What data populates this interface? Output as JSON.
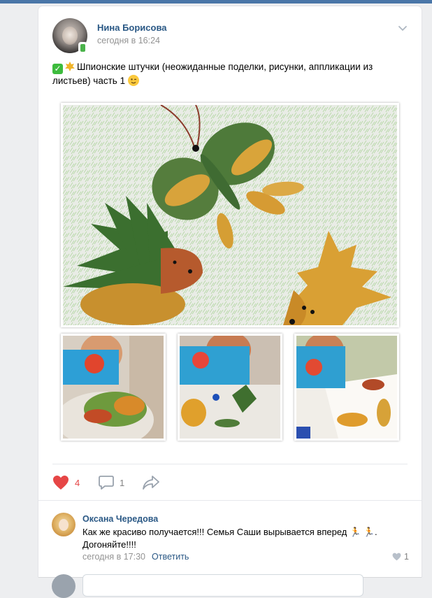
{
  "post": {
    "author": "Нина Борисова",
    "time": "сегодня в 16:24",
    "text": "Шпионские штучки (неожиданные поделки, рисунки, аппликации из листьев) часть 1"
  },
  "actions": {
    "likes": "4",
    "comments": "1"
  },
  "comment": {
    "author": "Оксана Чередова",
    "text": "Как же красиво получается!!! Семья Саши вырывается вперед 🏃 🏃. Догоняйте!!!!",
    "time": "сегодня в 17:30",
    "reply": "Ответить",
    "likes": "1"
  },
  "colors": {
    "link": "#2a5885",
    "like_active": "#e64646",
    "muted": "#939393",
    "brand_bar": "#4a76a8"
  },
  "icons": [
    "mobile-badge-icon",
    "chevron-down-icon",
    "check-emoji",
    "leaf-emoji",
    "wink-emoji",
    "heart-icon",
    "comment-icon",
    "share-icon",
    "small-heart-icon"
  ]
}
